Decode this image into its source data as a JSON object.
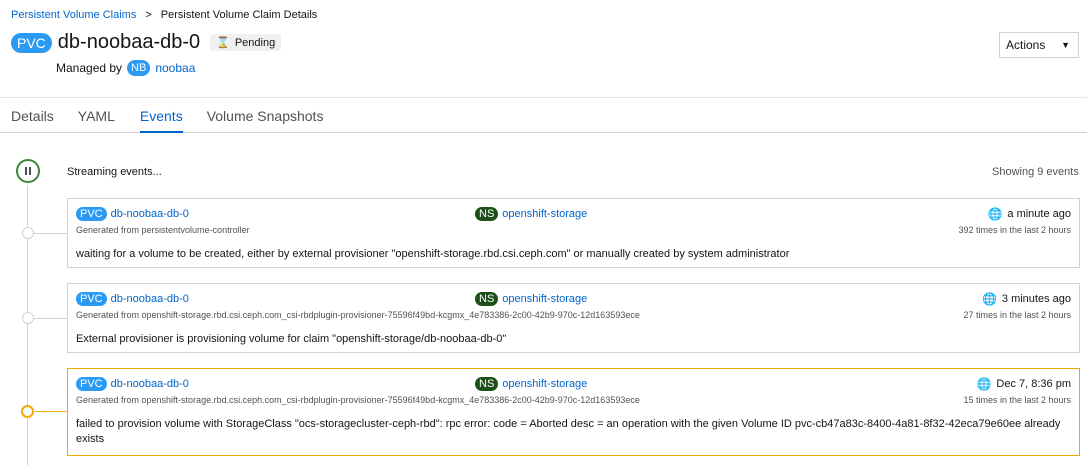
{
  "breadcrumb": {
    "parent": "Persistent Volume Claims",
    "separator": ">",
    "current": "Persistent Volume Claim Details"
  },
  "header": {
    "kind_badge": "PVC",
    "title": "db-noobaa-db-0",
    "status_icon": "hourglass-icon",
    "status": "Pending",
    "managed_by_label": "Managed by",
    "owner_badge": "NB",
    "owner": "noobaa",
    "actions_label": "Actions"
  },
  "tabs": [
    {
      "label": "Details",
      "active": false
    },
    {
      "label": "YAML",
      "active": false
    },
    {
      "label": "Events",
      "active": true
    },
    {
      "label": "Volume Snapshots",
      "active": false
    }
  ],
  "events_header": {
    "streaming": "Streaming events...",
    "showing": "Showing 9 events"
  },
  "events": [
    {
      "kind_badge": "PVC",
      "name": "db-noobaa-db-0",
      "ns_badge": "NS",
      "namespace": "openshift-storage",
      "generated": "Generated from persistentvolume-controller",
      "time": "a minute ago",
      "count": "392 times in the last 2 hours",
      "message": "waiting for a volume to be created, either by external provisioner \"openshift-storage.rbd.csi.ceph.com\" or manually created by system administrator",
      "level": "normal"
    },
    {
      "kind_badge": "PVC",
      "name": "db-noobaa-db-0",
      "ns_badge": "NS",
      "namespace": "openshift-storage",
      "generated": "Generated from openshift-storage.rbd.csi.ceph.com_csi-rbdplugin-provisioner-75596f49bd-kcgmx_4e783386-2c00-42b9-970c-12d163593ece",
      "time": "3 minutes ago",
      "count": "27 times in the last 2 hours",
      "message": "External provisioner is provisioning volume for claim \"openshift-storage/db-noobaa-db-0\"",
      "level": "normal"
    },
    {
      "kind_badge": "PVC",
      "name": "db-noobaa-db-0",
      "ns_badge": "NS",
      "namespace": "openshift-storage",
      "generated": "Generated from openshift-storage.rbd.csi.ceph.com_csi-rbdplugin-provisioner-75596f49bd-kcgmx_4e783386-2c00-42b9-970c-12d163593ece",
      "time": "Dec 7, 8:36 pm",
      "count": "15 times in the last 2 hours",
      "message": "failed to provision volume with StorageClass \"ocs-storagecluster-ceph-rbd\": rpc error: code = Aborted desc = an operation with the given Volume ID pvc-cb47a83c-8400-4a81-8f32-42eca79e60ee already exists",
      "level": "warning"
    }
  ],
  "colors": {
    "link": "#0066cc",
    "pvc_badge": "#2b9af3",
    "ns_badge": "#1e4f18",
    "warning": "#f0ab00",
    "streaming_ok": "#3e8635"
  }
}
